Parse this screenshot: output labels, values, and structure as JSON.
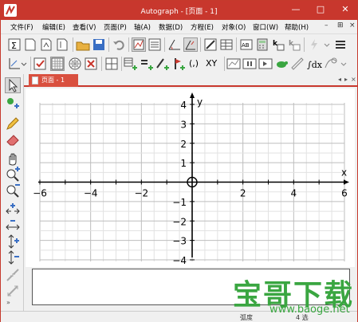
{
  "window": {
    "title": "Autograph - [页面 - 1]"
  },
  "menu": [
    "文件(F)",
    "编辑(E)",
    "查看(V)",
    "页面(P)",
    "轴(A)",
    "数据(D)",
    "方程(E)",
    "对象(O)",
    "窗口(W)",
    "帮助(H)"
  ],
  "tab": {
    "label": "页面 - 1"
  },
  "toolbar2": {
    "xy_label": "XY",
    "paren_label": "(,)"
  },
  "axes": {
    "x_label": "x",
    "y_label": "y",
    "x_ticks": [
      "−6",
      "−4",
      "−2",
      "2",
      "4",
      "6"
    ],
    "y_ticks": [
      "4",
      "3",
      "2",
      "1",
      "−1",
      "−2",
      "−3",
      "−4"
    ],
    "xlim": [
      -6,
      6
    ],
    "ylim": [
      -4,
      4
    ],
    "grid": true
  },
  "status": {
    "left": "弧度",
    "right": "4 选"
  },
  "watermark": {
    "cn": "宝哥下载",
    "url": "www.baoge.net"
  },
  "colors": {
    "title": "#c8372d",
    "tab": "#d9503f",
    "watermark": "#3aa641"
  }
}
